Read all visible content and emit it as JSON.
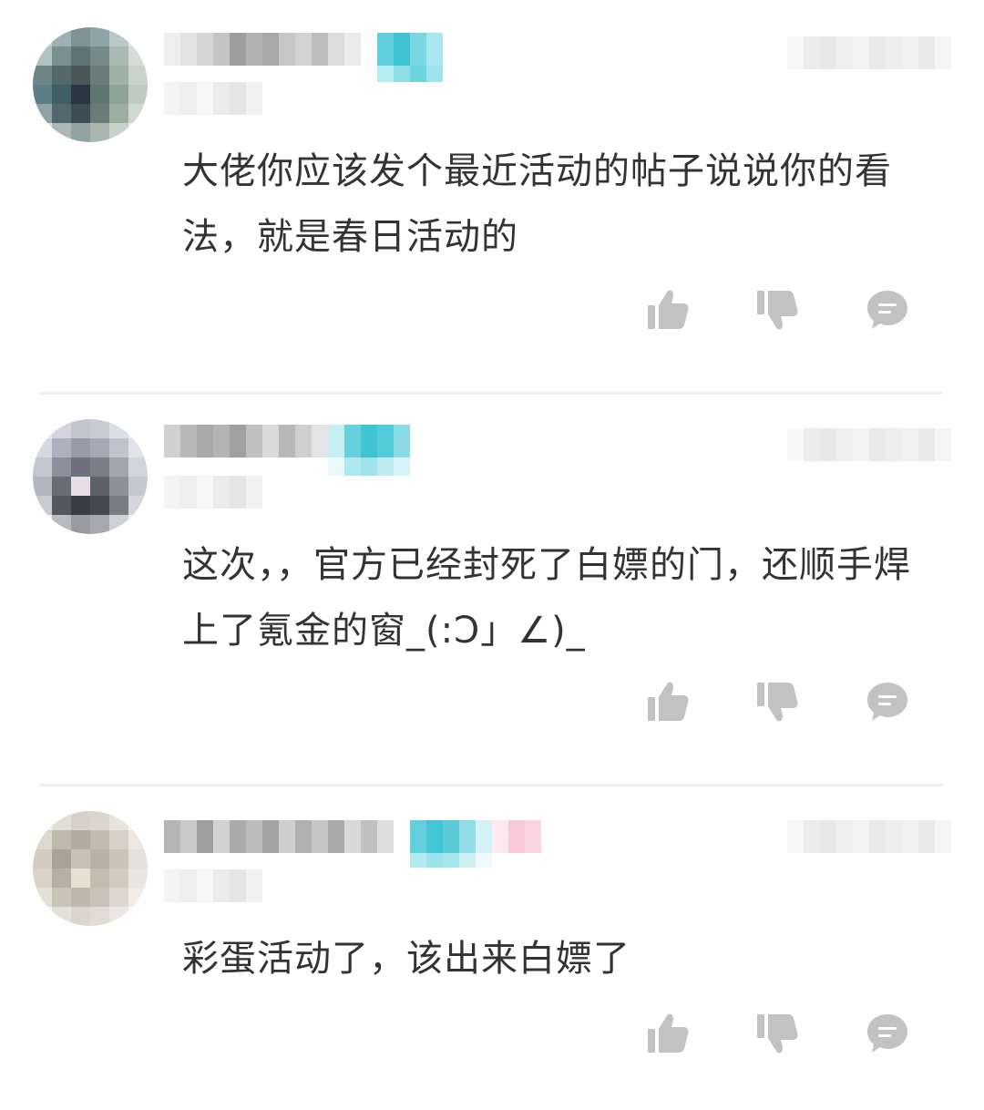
{
  "colors": {
    "icon": "#c2c2c2",
    "text": "#333333",
    "divider": "#eeeeee",
    "badge": "#4ac6d6"
  },
  "comments": [
    {
      "text": "大佬你应该发个最近活动的帖子说说你的看法，就是春日活动的",
      "actions": {
        "like_icon": "thumbs-up-icon",
        "dislike_icon": "thumbs-down-icon",
        "reply_icon": "comment-bubble-icon"
      }
    },
    {
      "text": "这次，，官方已经封死了白嫖的门，还顺手焊上了氪金的窗_(:Ɔ」∠)_",
      "actions": {
        "like_icon": "thumbs-up-icon",
        "dislike_icon": "thumbs-down-icon",
        "reply_icon": "comment-bubble-icon"
      }
    },
    {
      "text": "彩蛋活动了，该出来白嫖了",
      "actions": {
        "like_icon": "thumbs-up-icon",
        "dislike_icon": "thumbs-down-icon",
        "reply_icon": "comment-bubble-icon"
      }
    }
  ]
}
